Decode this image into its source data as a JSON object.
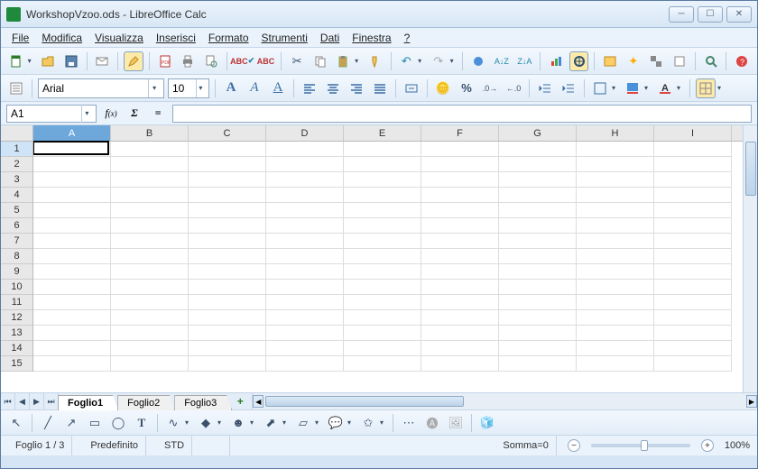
{
  "window": {
    "title": "WorkshopVzoo.ods - LibreOffice Calc"
  },
  "menu": [
    "File",
    "Modifica",
    "Visualizza",
    "Inserisci",
    "Formato",
    "Strumenti",
    "Dati",
    "Finestra",
    "?"
  ],
  "format": {
    "font": "Arial",
    "size": "10"
  },
  "formula": {
    "cellref": "A1",
    "value": ""
  },
  "columns": [
    "A",
    "B",
    "C",
    "D",
    "E",
    "F",
    "G",
    "H",
    "I"
  ],
  "rows": [
    "1",
    "2",
    "3",
    "4",
    "5",
    "6",
    "7",
    "8",
    "9",
    "10",
    "11",
    "12",
    "13",
    "14",
    "15"
  ],
  "selected": {
    "col": 0,
    "row": 0
  },
  "sheet_tabs": [
    "Foglio1",
    "Foglio2",
    "Foglio3"
  ],
  "active_tab": 0,
  "status": {
    "sheet": "Foglio 1 / 3",
    "pagestyle": "Predefinito",
    "mode": "STD",
    "sum": "Somma=0",
    "zoom": "100%"
  }
}
